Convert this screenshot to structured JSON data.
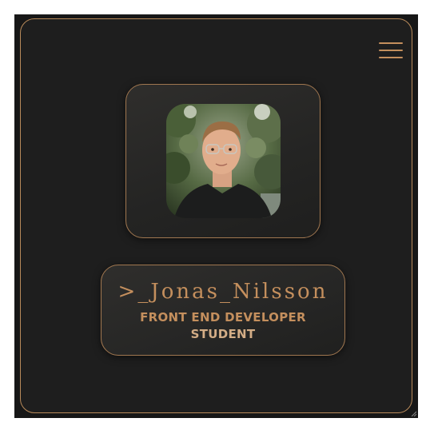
{
  "profile": {
    "name": ">_Jonas_Nilsson",
    "role_line1": "FRONT END DEVELOPER",
    "role_line2": "STUDENT"
  },
  "menu": {
    "icon": "hamburger-menu-icon"
  },
  "colors": {
    "accent": "#c48f5d",
    "accent_light": "#d3ad86",
    "background": "#1e1e1e",
    "border": "#b88a5a"
  }
}
